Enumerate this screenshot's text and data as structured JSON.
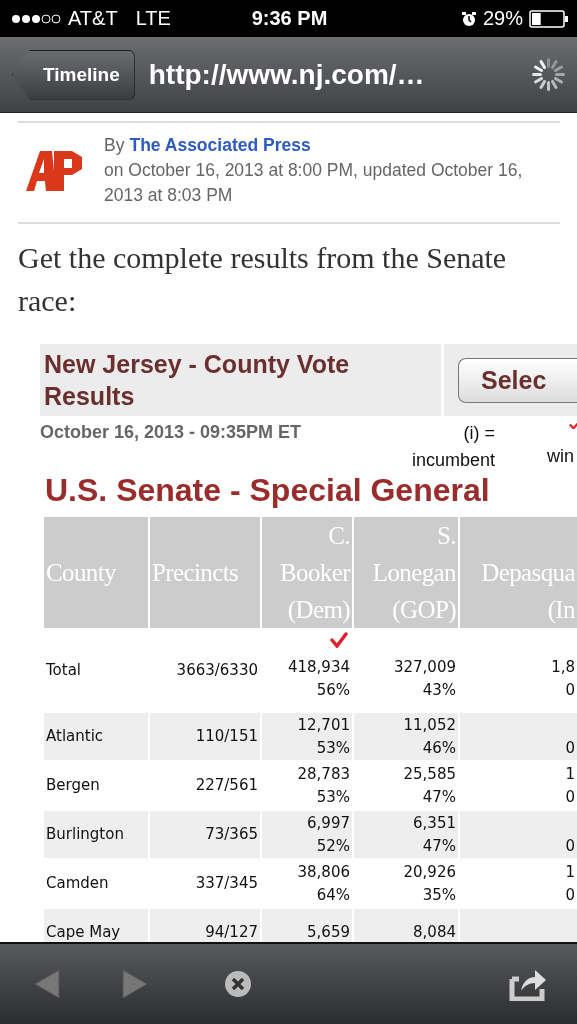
{
  "status_bar": {
    "carrier": "AT&T",
    "network": "LTE",
    "time": "9:36 PM",
    "battery": "29%"
  },
  "nav_bar": {
    "back_button": "Timeline",
    "url": "http://www.nj.com/…"
  },
  "article": {
    "byline_prefix": "By",
    "author": "The Associated Press",
    "dateline": "on October 16, 2013 at 8:00 PM, updated October 16, 2013 at 8:03 PM",
    "intro": "Get the complete results from the Senate race:"
  },
  "results": {
    "title": "New Jersey - County Vote Results",
    "select_button": "Selec",
    "updated": "October 16, 2013 - 09:35PM ET",
    "legend": [
      {
        "kind": "incumbent",
        "text": "(i) = incumbent"
      },
      {
        "kind": "winner",
        "text": "win"
      }
    ],
    "race_title": "U.S. Senate - Special General",
    "columns": [
      {
        "lines": [
          "County"
        ]
      },
      {
        "lines": [
          "Precincts"
        ]
      },
      {
        "lines": [
          "C.",
          "Booker",
          "(Dem)"
        ]
      },
      {
        "lines": [
          "S.",
          "Lonegan",
          "(GOP)"
        ]
      },
      {
        "lines": [
          "Depasqua",
          "(In"
        ]
      }
    ],
    "rows": [
      {
        "cells": [
          {
            "text": "Total"
          },
          {
            "text": "3663/6330"
          },
          {
            "votes": "418,934",
            "pct": "56%",
            "winner": true
          },
          {
            "votes": "327,009",
            "pct": "43%",
            "winner": false
          },
          {
            "votes": "1,8",
            "pct": "0",
            "winner": false
          }
        ]
      },
      {
        "cells": [
          {
            "text": "Atlantic"
          },
          {
            "text": "110/151"
          },
          {
            "votes": "12,701",
            "pct": "53%",
            "winner": false
          },
          {
            "votes": "11,052",
            "pct": "46%",
            "winner": false
          },
          {
            "pct": "0",
            "winner": false
          }
        ]
      },
      {
        "cells": [
          {
            "text": "Bergen"
          },
          {
            "text": "227/561"
          },
          {
            "votes": "28,783",
            "pct": "53%",
            "winner": false
          },
          {
            "votes": "25,585",
            "pct": "47%",
            "winner": false
          },
          {
            "votes": "1",
            "pct": "0",
            "winner": false
          }
        ]
      },
      {
        "cells": [
          {
            "text": "Burlington"
          },
          {
            "text": "73/365"
          },
          {
            "votes": "6,997",
            "pct": "52%",
            "winner": false
          },
          {
            "votes": "6,351",
            "pct": "47%",
            "winner": false
          },
          {
            "pct": "0",
            "winner": false
          }
        ]
      },
      {
        "cells": [
          {
            "text": "Camden"
          },
          {
            "text": "337/345"
          },
          {
            "votes": "38,806",
            "pct": "64%",
            "winner": false
          },
          {
            "votes": "20,926",
            "pct": "35%",
            "winner": false
          },
          {
            "votes": "1",
            "pct": "0",
            "winner": false
          }
        ]
      },
      {
        "cells": [
          {
            "text": "Cape May"
          },
          {
            "text": "94/127"
          },
          {
            "votes": "5,659",
            "winner": false
          },
          {
            "votes": "8,084",
            "winner": false
          },
          {
            "winner": false
          }
        ]
      }
    ]
  }
}
